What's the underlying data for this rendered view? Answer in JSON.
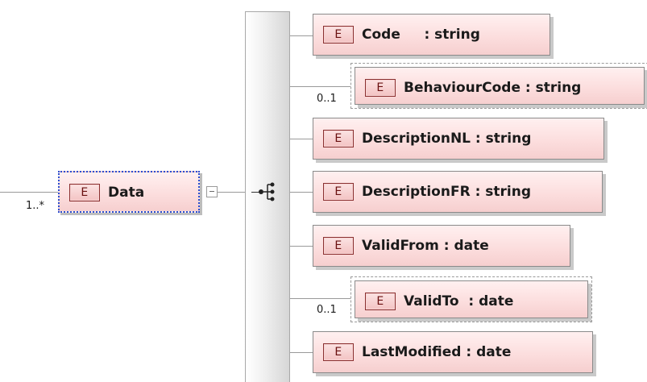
{
  "root_element": {
    "badge": "E",
    "label": "Data",
    "occurrence": "1..*",
    "icon": "element-icon"
  },
  "compositor": {
    "type": "sequence",
    "icon": "sequence-compositor-icon",
    "toggle_icon": "collapse-minus-icon"
  },
  "children": [
    {
      "badge": "E",
      "label": "Code     : string",
      "occurrence": "",
      "optional": false
    },
    {
      "badge": "E",
      "label": "BehaviourCode : string",
      "occurrence": "0..1",
      "optional": true
    },
    {
      "badge": "E",
      "label": "DescriptionNL : string",
      "occurrence": "",
      "optional": false
    },
    {
      "badge": "E",
      "label": "DescriptionFR : string",
      "occurrence": "",
      "optional": false
    },
    {
      "badge": "E",
      "label": "ValidFrom : date",
      "occurrence": "",
      "optional": false
    },
    {
      "badge": "E",
      "label": "ValidTo  : date",
      "occurrence": "0..1",
      "optional": true
    },
    {
      "badge": "E",
      "label": "LastModified : date",
      "occurrence": "",
      "optional": false
    }
  ],
  "colors": {
    "element_fill": "#fcdede",
    "element_border": "#8a8a8a",
    "selection_border": "#2c4fd1",
    "badge_text": "#6a1010"
  }
}
